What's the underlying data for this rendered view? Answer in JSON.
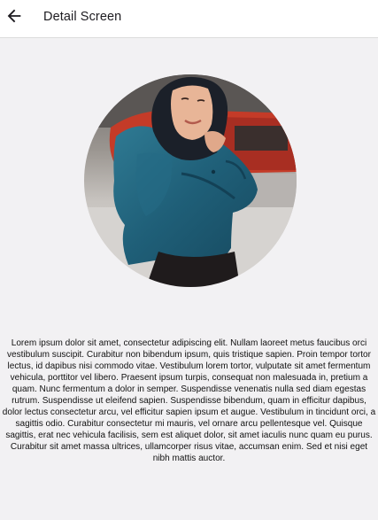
{
  "app_bar": {
    "title": "Detail Screen",
    "back_icon": "arrow-back-icon"
  },
  "content": {
    "image_icon": "portrait-photo",
    "body_text": "Lorem ipsum dolor sit amet, consectetur adipiscing elit. Nullam laoreet metus faucibus orci vestibulum suscipit. Curabitur non bibendum ipsum, quis tristique sapien. Proin tempor tortor lectus, id dapibus nisi commodo vitae. Vestibulum lorem tortor, vulputate sit amet fermentum vehicula, porttitor vel libero. Praesent ipsum turpis, consequat non malesuada in, pretium a quam. Nunc fermentum a dolor in semper. Suspendisse venenatis nulla sed diam egestas rutrum. Suspendisse ut eleifend sapien. Suspendisse bibendum, quam in efficitur dapibus, dolor lectus consectetur arcu, vel efficitur sapien ipsum et augue. Vestibulum in tincidunt orci, a sagittis odio. Curabitur consectetur mi mauris, vel ornare arcu pellentesque vel. Quisque sagittis, erat nec vehicula facilisis, sem est aliquet dolor, sit amet iaculis nunc quam eu purus. Curabitur sit amet massa ultrices, ullamcorper risus vitae, accumsan enim. Sed et nisi eget nibh mattis auctor."
  },
  "colors": {
    "background": "#f2f1f3",
    "app_bar": "#ffffff",
    "text": "#111111"
  }
}
